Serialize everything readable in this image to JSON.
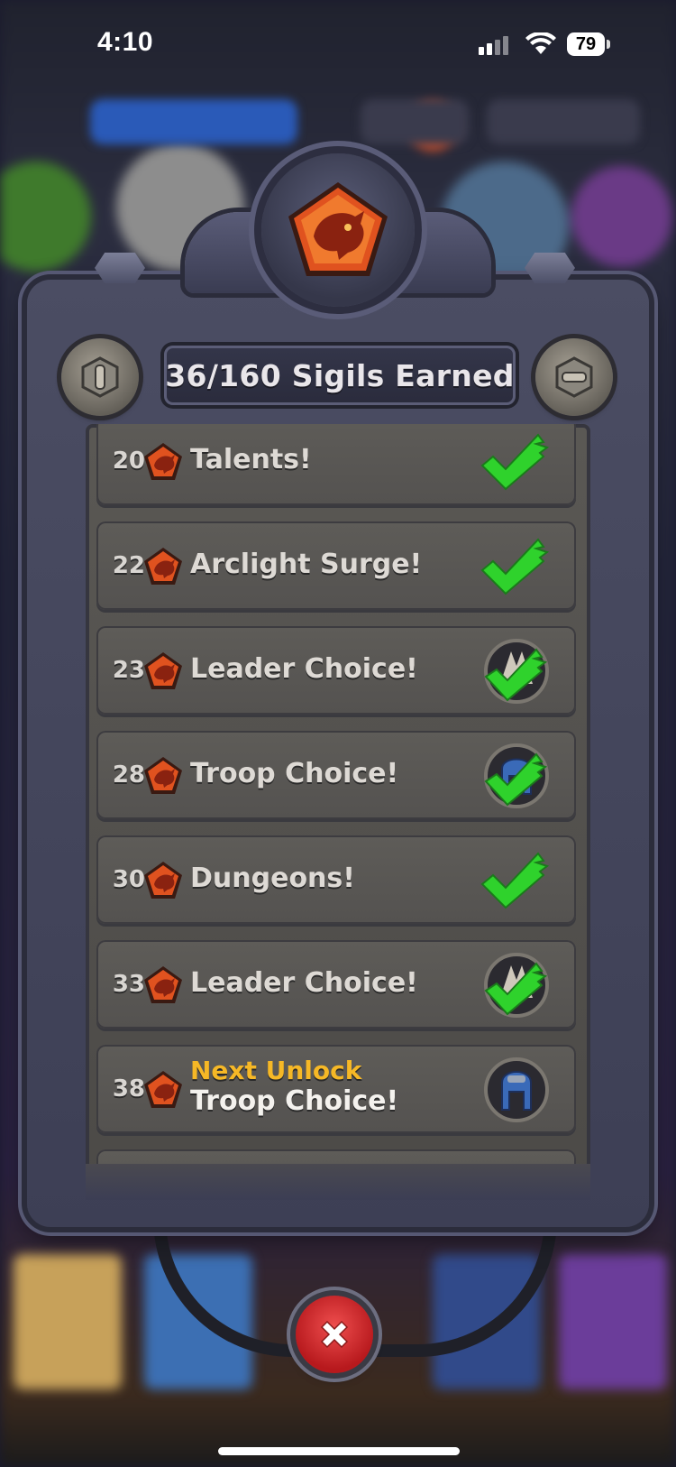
{
  "status_bar": {
    "time": "4:10",
    "battery": "79"
  },
  "panel": {
    "title": "36/160 Sigils Earned",
    "emblem_icon": "dragon-sigil-icon"
  },
  "rewards": [
    {
      "sigils": "20",
      "label": "Talents!",
      "status": "claimed",
      "icon": "check-icon"
    },
    {
      "sigils": "22",
      "label": "Arclight Surge!",
      "status": "claimed",
      "icon": "check-icon"
    },
    {
      "sigils": "23",
      "label": "Leader Choice!",
      "status": "claimed",
      "icon": "leader-helmet-check-icon"
    },
    {
      "sigils": "28",
      "label": "Troop Choice!",
      "status": "claimed",
      "icon": "troop-helmet-check-icon"
    },
    {
      "sigils": "30",
      "label": "Dungeons!",
      "status": "claimed",
      "icon": "check-icon"
    },
    {
      "sigils": "33",
      "label": "Leader Choice!",
      "status": "claimed",
      "icon": "leader-helmet-check-icon"
    },
    {
      "sigils": "38",
      "next_label": "Next Unlock",
      "label": "Troop Choice!",
      "status": "next",
      "icon": "troop-helmet-icon"
    }
  ],
  "colors": {
    "next_unlock": "#f6b826",
    "check_green": "#2fd22c",
    "sigil_orange": "#d8491c",
    "close_red": "#d8262a"
  },
  "close_button": {
    "icon": "close-x-icon"
  }
}
